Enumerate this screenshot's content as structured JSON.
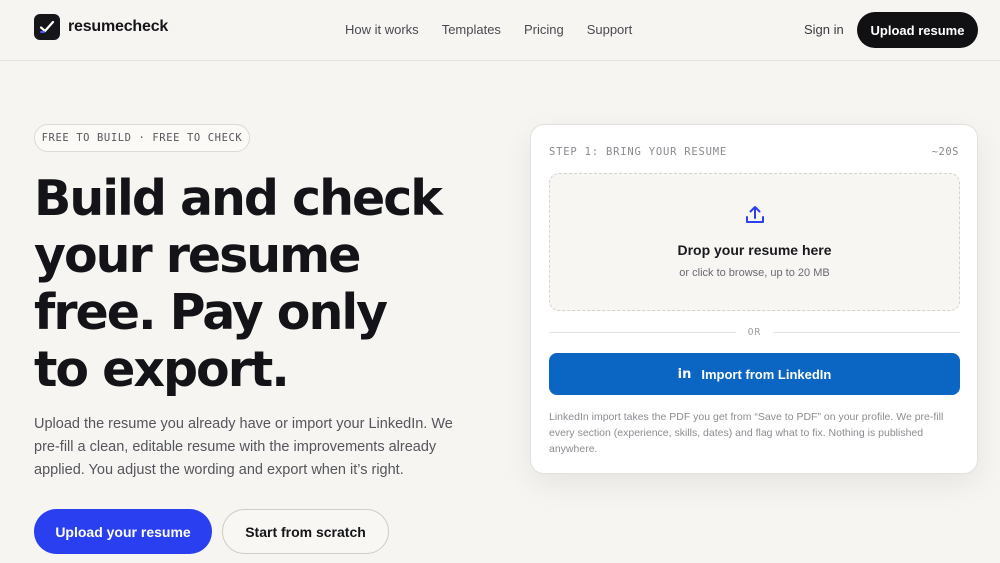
{
  "brand": {
    "name": "resumecheck"
  },
  "nav": {
    "items": [
      "How it works",
      "Templates",
      "Pricing",
      "Support"
    ]
  },
  "header": {
    "signin": "Sign in",
    "upload": "Upload resume"
  },
  "hero": {
    "badge": "FREE TO BUILD · FREE TO CHECK",
    "headline": [
      "Build and check",
      "your resume",
      "free. Pay only",
      "to export."
    ],
    "subcopy": "Upload the resume you already have or import your LinkedIn. We pre-fill a clean, editable resume with the improvements already applied. You adjust the wording and export when it’s right.",
    "primary_cta": "Upload your resume",
    "secondary_cta": "Start from scratch"
  },
  "card": {
    "step_label": "STEP 1: BRING YOUR RESUME",
    "time": "~20S",
    "drop_title": "Drop your resume here",
    "drop_sub": "or click to browse, up to 20 MB",
    "or": "OR",
    "linkedin_icon": "in",
    "linkedin_label": "Import from LinkedIn",
    "note": "LinkedIn import takes the PDF you get from “Save to PDF” on your profile. We pre-fill every section (experience, skills, dates) and flag what to fix. Nothing is published anywhere."
  },
  "colors": {
    "primary": "#2a3ff0",
    "linkedin": "#0a66c2",
    "dark": "#111114"
  },
  "icons": {
    "logo": "check-icon",
    "upload": "upload-icon"
  }
}
